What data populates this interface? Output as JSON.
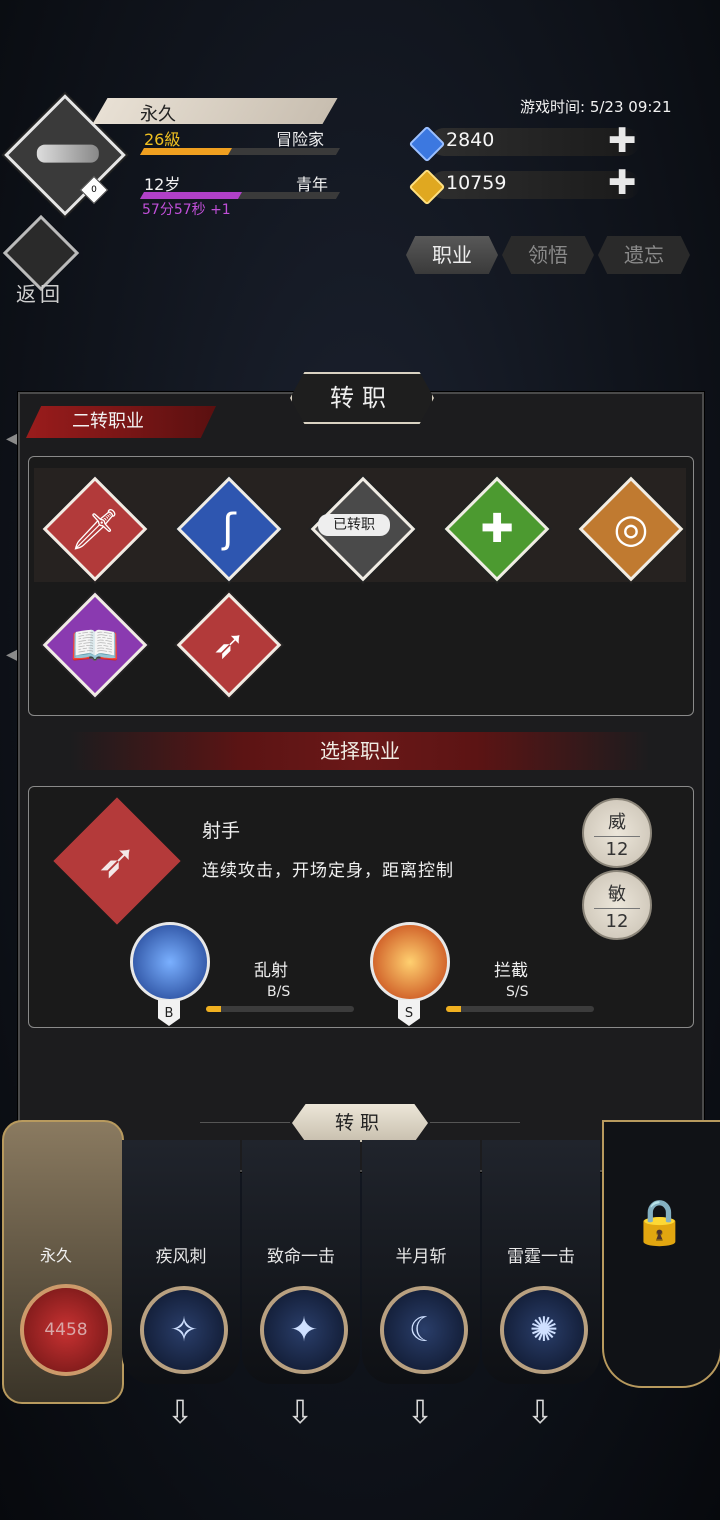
{
  "status": {
    "game_time": "游戏时间: 5/23 09:21"
  },
  "player": {
    "name": "永久",
    "level": "26級",
    "job": "冒险家",
    "level_progress": 0.45,
    "age": "12岁",
    "stage": "青年",
    "age_progress": 0.5,
    "timer": "57分57秒 +1",
    "rank_badge": "0"
  },
  "currency": [
    {
      "name": "gem",
      "value": "2840",
      "color": "#3c78e0"
    },
    {
      "name": "gold",
      "value": "10759",
      "color": "#e0a820"
    }
  ],
  "nav": {
    "back_label": "返回"
  },
  "tabs": [
    {
      "label": "职业",
      "active": true
    },
    {
      "label": "领悟",
      "active": false
    },
    {
      "label": "遗忘",
      "active": false
    }
  ],
  "panel": {
    "title": "转职",
    "section_tag": "二转职业",
    "classes": [
      {
        "icon": "sword-icon",
        "glyph": "🗡",
        "color": "#b23a3a"
      },
      {
        "icon": "staff-icon",
        "glyph": "ʃ",
        "color": "#2e56b0"
      },
      {
        "icon": "hammer-icon",
        "glyph": "",
        "color": "#4a4a4a",
        "status": "已转职"
      },
      {
        "icon": "cross-icon",
        "glyph": "✚",
        "color": "#4c9a30"
      },
      {
        "icon": "ring-icon",
        "glyph": "◎",
        "color": "#c07a30"
      },
      {
        "icon": "book-icon",
        "glyph": "📖",
        "color": "#8a3ab0"
      },
      {
        "icon": "bow-icon",
        "glyph": "➶",
        "color": "#b23a3a"
      }
    ],
    "choose_label": "选择职业",
    "detail": {
      "name": "射手",
      "description": "连续攻击，开场定身，距离控制",
      "stats": [
        {
          "label": "威",
          "value": "12"
        },
        {
          "label": "敏",
          "value": "12"
        }
      ],
      "skills": [
        {
          "name": "乱射",
          "grade": "B",
          "rank": "B/S",
          "progress": 0.1
        },
        {
          "name": "拦截",
          "grade": "S",
          "rank": "S/S",
          "progress": 0.1
        }
      ]
    },
    "confirm_label": "转职"
  },
  "hero": {
    "name": "永久",
    "hp": "4458"
  },
  "skill_slots": [
    {
      "name": "疾风刺",
      "glyph": "✧"
    },
    {
      "name": "致命一击",
      "glyph": "✦"
    },
    {
      "name": "半月斩",
      "glyph": "☾"
    },
    {
      "name": "雷霆一击",
      "glyph": "✺"
    }
  ],
  "glyphs": {
    "plus": "✚",
    "lock": "🔒",
    "down_arrow": "⇩",
    "left_arrow": "◀"
  }
}
